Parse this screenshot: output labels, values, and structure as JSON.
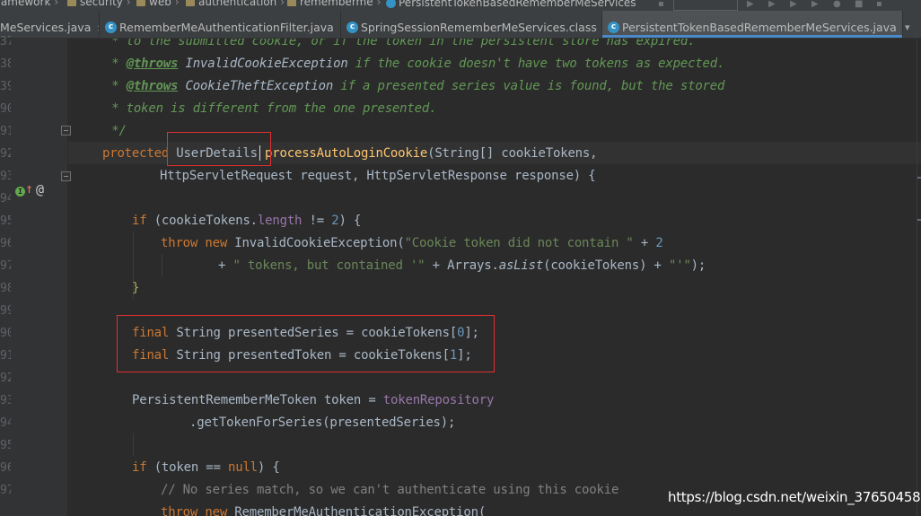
{
  "breadcrumb": [
    {
      "label": "ramework",
      "icon": "none"
    },
    {
      "label": "security",
      "icon": "folder-icon"
    },
    {
      "label": "web",
      "icon": "folder-icon"
    },
    {
      "label": "authentication",
      "icon": "folder-icon"
    },
    {
      "label": "rememberme",
      "icon": "folder-icon"
    },
    {
      "label": "PersistentTokenBasedRememberMeServices",
      "icon": "class-icon"
    }
  ],
  "tabs": [
    {
      "label": "MeServices.java",
      "icon": "none",
      "active": false
    },
    {
      "label": "RememberMeAuthenticationFilter.java",
      "icon": "class-icon",
      "active": false
    },
    {
      "label": "SpringSessionRememberMeServices.class",
      "icon": "class-icon",
      "active": false
    },
    {
      "label": "PersistentTokenBasedRememberMeServices.java",
      "icon": "class-icon",
      "active": true
    }
  ],
  "tab_close_glyph": "×",
  "tab_overflow_glyph": "▾",
  "class_icon_letter": "c",
  "gutter": {
    "line_numbers": [
      "37",
      "38",
      "39",
      "90",
      "91",
      "92",
      "93",
      "94",
      "95",
      "96",
      "97",
      "98",
      "99",
      "90",
      "91",
      "92",
      "93",
      "94",
      "95",
      "96",
      "97"
    ],
    "implements_icon": "I",
    "override_arrow": "↑",
    "annotation_icon": "@"
  },
  "code": {
    "l1": {
      "doc": " * to the submitted cookie, or if the token in the persistent store has expired."
    },
    "l2": {
      "star": " * ",
      "tag": "@throws",
      "ref": " InvalidCookieException",
      "doc": " if the cookie doesn't have two tokens as expected."
    },
    "l3": {
      "star": " * ",
      "tag": "@throws",
      "ref": " CookieTheftException",
      "doc": " if a presented series value is found, but the stored"
    },
    "l4": {
      "doc": " * token is different from the one presented."
    },
    "l5": {
      "doc": " */"
    },
    "l6": {
      "kw": "protected",
      "type": " UserDetails ",
      "fn": "processAutoLoginCookie",
      "rest": "(String[] cookieTokens,"
    },
    "l7": {
      "text": "HttpServletRequest request, HttpServletResponse response) {"
    },
    "l8": {
      "kw": "if",
      "a": " (cookieTokens.",
      "fld": "length",
      "b": " != ",
      "num": "2",
      "c": ") {"
    },
    "l9": {
      "kw": "throw new",
      "a": " InvalidCookieException(",
      "str": "\"Cookie token did not contain \"",
      "b": " + ",
      "num": "2"
    },
    "l10": {
      "a": "+ ",
      "str1": "\" tokens, but contained '\"",
      "b": " + Arrays.",
      "it": "asList",
      "c": "(cookieTokens) + ",
      "str2": "\"'\"",
      "d": ");"
    },
    "l11": {
      "text": "}"
    },
    "l12": {
      "kw": "final",
      "a": " String presentedSeries = cookieTokens[",
      "num": "0",
      "b": "];"
    },
    "l13": {
      "kw": "final",
      "a": " String presentedToken = cookieTokens[",
      "num": "1",
      "b": "];"
    },
    "l14": {
      "a": "PersistentRememberMeToken token = ",
      "fld": "tokenRepository"
    },
    "l15": {
      "a": ".getTokenForSeries(presentedSeries);"
    },
    "l16": {
      "kw": "if",
      "a": " (token == ",
      "kw2": "null",
      "b": ") {"
    },
    "l17": {
      "com": "// No series match, so we can't authenticate using this cookie"
    },
    "l18": {
      "kw": "throw new",
      "a": " RememberMeAuthenticationException("
    }
  },
  "watermark": "https://blog.csdn.net/weixin_37650458",
  "colors": {
    "background": "#2b2b2b",
    "highlight_box": "#e03030",
    "active_tab_indicator": "#4a88c7"
  }
}
